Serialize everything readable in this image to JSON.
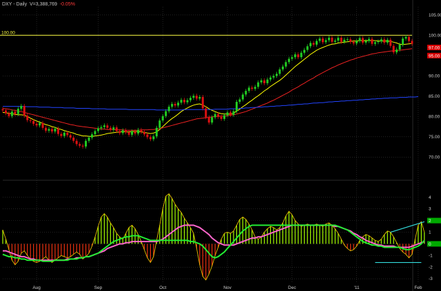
{
  "header": {
    "symbol": "DXY",
    "interval": "Daily",
    "sep": " - ",
    "volume": "V=3,388,769",
    "change": "-0.05%"
  },
  "reference_line": {
    "label": "100.00",
    "value": 100
  },
  "colors": {
    "background": "#000000",
    "grid": "#3a3a3a",
    "up_candle": "#22cc22",
    "down_candle": "#dd1111",
    "sma_short": "#ffff00",
    "sma_mid": "#ee2222",
    "sma_long": "#2244ff",
    "reference": "#ffff44",
    "hist_pos": "#a6ff00",
    "hist_neg": "#ee3311",
    "osc_line": "#ff66cc",
    "signal_line": "#22ee33",
    "divergence": "#33dddd",
    "axis_text": "#cfcfcf"
  },
  "chart_data": {
    "type": "candlestick",
    "price_axis": {
      "ticks": [
        "105.00",
        "100.00",
        "95.00",
        "90.00",
        "85.00",
        "80.00",
        "75.00",
        "70.00"
      ],
      "ylim": [
        67,
        107
      ],
      "current_labels": [
        "97.00",
        "95.00"
      ]
    },
    "osc_axis": {
      "ticks": [
        "4",
        "3",
        "2",
        "1",
        "0",
        "-1",
        "-2",
        "-3"
      ],
      "ylim": [
        -3.4,
        4.4
      ],
      "current_labels": [
        "2",
        "0"
      ]
    },
    "x_labels": [
      "Aug",
      "Sep",
      "Oct",
      "Nov",
      "Dec",
      "'11",
      "Feb"
    ],
    "x_label_index": [
      11,
      31,
      52,
      73,
      94,
      115,
      135
    ],
    "close": [
      81.5,
      80.8,
      80.1,
      81.2,
      80.6,
      81.9,
      82.6,
      80.2,
      79.1,
      78.9,
      78.2,
      77.8,
      78.4,
      77.2,
      76.5,
      76.9,
      76.3,
      77.0,
      75.7,
      75.2,
      76.0,
      75.4,
      74.8,
      74.0,
      73.2,
      72.8,
      72.6,
      74.0,
      74.8,
      75.6,
      76.4,
      77.1,
      77.4,
      77.8,
      77.2,
      76.7,
      77.3,
      76.4,
      75.9,
      76.6,
      76.1,
      75.5,
      76.3,
      75.8,
      76.7,
      76.2,
      75.6,
      74.9,
      74.4,
      75.1,
      77.2,
      79.0,
      80.1,
      81.3,
      82.4,
      83.1,
      82.7,
      83.4,
      84.1,
      83.5,
      84.0,
      84.6,
      85.1,
      84.4,
      84.8,
      82.0,
      79.8,
      78.5,
      79.8,
      80.6,
      79.9,
      79.4,
      80.3,
      81.0,
      80.4,
      81.3,
      83.6,
      84.2,
      85.4,
      86.3,
      87.1,
      86.8,
      87.3,
      88.4,
      88.9,
      88.2,
      89.1,
      89.6,
      90.0,
      90.5,
      91.6,
      92.3,
      93.4,
      94.2,
      94.6,
      95.3,
      94.6,
      95.7,
      96.4,
      97.3,
      98.1,
      97.7,
      98.6,
      99.2,
      98.3,
      98.8,
      99.4,
      98.4,
      98.7,
      99.4,
      98.4,
      98.9,
      99.0,
      98.4,
      98.0,
      98.6,
      99.3,
      98.2,
      98.6,
      99.1,
      97.9,
      98.3,
      98.5,
      99.0,
      98.2,
      98.9,
      97.4,
      95.8,
      96.5,
      97.7,
      99.2,
      99.6,
      98.6,
      97.9
    ],
    "series": [
      {
        "name": "SMA short",
        "values": [
          81.0,
          80.9,
          80.8,
          80.7,
          80.5,
          80.4,
          80.4,
          80.3,
          80.0,
          79.6,
          79.2,
          78.9,
          78.6,
          78.3,
          78.0,
          77.8,
          77.5,
          77.3,
          77.0,
          76.8,
          76.5,
          76.3,
          76.1,
          75.9,
          75.6,
          75.4,
          75.2,
          75.2,
          75.1,
          75.1,
          75.2,
          75.3,
          75.4,
          75.6,
          75.8,
          75.9,
          76.0,
          76.1,
          76.2,
          76.3,
          76.2,
          76.2,
          76.3,
          76.3,
          76.3,
          76.2,
          76.1,
          75.9,
          75.8,
          75.9,
          76.2,
          76.8,
          77.5,
          78.2,
          78.9,
          79.5,
          80.0,
          80.6,
          81.2,
          81.7,
          82.1,
          82.5,
          82.8,
          83.0,
          83.1,
          82.8,
          82.4,
          81.9,
          81.5,
          81.2,
          80.9,
          80.7,
          80.6,
          80.6,
          80.6,
          80.8,
          81.3,
          81.8,
          82.4,
          82.9,
          83.5,
          84.0,
          84.6,
          85.1,
          85.7,
          86.3,
          86.8,
          87.4,
          87.9,
          88.4,
          88.9,
          89.5,
          90.2,
          90.9,
          91.6,
          92.3,
          92.9,
          93.5,
          94.1,
          94.7,
          95.3,
          95.8,
          96.3,
          96.7,
          97.0,
          97.3,
          97.6,
          97.8,
          97.9,
          98.1,
          98.2,
          98.3,
          98.4,
          98.5,
          98.6,
          98.6,
          98.7,
          98.7,
          98.7,
          98.7,
          98.7,
          98.7,
          98.6,
          98.6,
          98.6,
          98.6,
          98.5,
          98.3,
          98.1,
          97.8,
          97.7,
          97.8,
          97.9,
          98.0
        ]
      },
      {
        "name": "SMA mid",
        "values": [
          82.0,
          81.9,
          81.8,
          81.6,
          81.5,
          81.3,
          81.2,
          81.0,
          80.8,
          80.6,
          80.4,
          80.2,
          80.0,
          79.8,
          79.6,
          79.4,
          79.2,
          79.0,
          78.8,
          78.6,
          78.4,
          78.2,
          78.0,
          77.9,
          77.7,
          77.6,
          77.5,
          77.4,
          77.3,
          77.2,
          77.1,
          77.0,
          76.9,
          76.9,
          76.8,
          76.8,
          76.8,
          76.7,
          76.7,
          76.7,
          76.6,
          76.6,
          76.6,
          76.6,
          76.6,
          76.7,
          76.7,
          76.7,
          76.8,
          76.8,
          76.9,
          77.0,
          77.2,
          77.4,
          77.6,
          77.8,
          78.0,
          78.2,
          78.4,
          78.6,
          78.8,
          79.0,
          79.2,
          79.4,
          79.5,
          79.6,
          79.7,
          79.8,
          79.9,
          80.0,
          80.0,
          80.1,
          80.1,
          80.2,
          80.3,
          80.4,
          80.6,
          80.8,
          81.0,
          81.2,
          81.5,
          81.8,
          82.1,
          82.4,
          82.7,
          83.0,
          83.3,
          83.7,
          84.0,
          84.4,
          84.8,
          85.2,
          85.6,
          86.0,
          86.5,
          86.9,
          87.3,
          87.8,
          88.2,
          88.7,
          89.1,
          89.5,
          90.0,
          90.4,
          90.8,
          91.2,
          91.6,
          92.0,
          92.3,
          92.7,
          93.0,
          93.3,
          93.6,
          93.9,
          94.1,
          94.4,
          94.6,
          94.8,
          95.0,
          95.2,
          95.4,
          95.5,
          95.7,
          95.8,
          95.9,
          96.0,
          96.1,
          96.2,
          96.3,
          96.3,
          96.4,
          96.5,
          96.6,
          96.7
        ]
      },
      {
        "name": "SMA long",
        "values": [
          82.5,
          82.5,
          82.5,
          82.5,
          82.5,
          82.5,
          82.5,
          82.5,
          82.4,
          82.4,
          82.4,
          82.4,
          82.3,
          82.3,
          82.3,
          82.3,
          82.2,
          82.2,
          82.2,
          82.2,
          82.1,
          82.1,
          82.1,
          82.1,
          82.0,
          82.0,
          82.0,
          82.0,
          82.0,
          81.9,
          81.9,
          81.9,
          81.9,
          81.9,
          81.8,
          81.8,
          81.8,
          81.8,
          81.8,
          81.8,
          81.8,
          81.7,
          81.7,
          81.7,
          81.7,
          81.7,
          81.7,
          81.7,
          81.7,
          81.7,
          81.6,
          81.6,
          81.6,
          81.6,
          81.6,
          81.6,
          81.6,
          81.6,
          81.6,
          81.7,
          81.7,
          81.7,
          81.7,
          81.7,
          81.7,
          81.7,
          81.7,
          81.7,
          81.7,
          81.8,
          81.8,
          81.8,
          81.8,
          81.8,
          81.9,
          81.9,
          81.9,
          82.0,
          82.0,
          82.1,
          82.1,
          82.2,
          82.2,
          82.3,
          82.3,
          82.4,
          82.4,
          82.5,
          82.5,
          82.6,
          82.6,
          82.7,
          82.7,
          82.8,
          82.8,
          82.9,
          83.0,
          83.0,
          83.1,
          83.1,
          83.2,
          83.3,
          83.3,
          83.4,
          83.4,
          83.5,
          83.6,
          83.6,
          83.7,
          83.7,
          83.8,
          83.8,
          83.9,
          83.9,
          84.0,
          84.0,
          84.1,
          84.1,
          84.2,
          84.2,
          84.3,
          84.3,
          84.4,
          84.4,
          84.5,
          84.5,
          84.6,
          84.6,
          84.6,
          84.7,
          84.7,
          84.7,
          84.8,
          84.8,
          84.8,
          84.9
        ]
      }
    ],
    "oscillator": {
      "histogram": [
        1.2,
        0.4,
        -0.5,
        -1.4,
        -1.8,
        -1.5,
        -0.8,
        -0.6,
        -1.0,
        -1.3,
        -1.5,
        -1.6,
        -1.5,
        -1.3,
        -1.1,
        -1.4,
        -1.6,
        -1.4,
        -1.2,
        -1.0,
        -1.1,
        -1.2,
        -1.1,
        -0.9,
        -0.7,
        -0.9,
        -1.3,
        -1.1,
        -0.8,
        -0.2,
        0.6,
        1.5,
        2.3,
        2.6,
        2.3,
        1.8,
        1.4,
        0.9,
        0.6,
        0.4,
        0.9,
        1.4,
        1.6,
        1.3,
        0.8,
        0.2,
        -0.5,
        -1.2,
        -1.6,
        -1.1,
        0.3,
        1.6,
        3.0,
        4.1,
        4.3,
        3.9,
        3.4,
        3.0,
        2.7,
        2.2,
        1.8,
        1.4,
        0.9,
        -0.4,
        -1.8,
        -2.8,
        -3.1,
        -2.6,
        -1.9,
        -1.0,
        -0.3,
        0.4,
        0.9,
        1.0,
        0.9,
        1.1,
        1.6,
        2.1,
        2.3,
        2.1,
        1.7,
        1.2,
        0.6,
        0.4,
        0.6,
        1.0,
        1.3,
        1.5,
        1.4,
        1.2,
        1.4,
        1.8,
        2.4,
        2.8,
        2.5,
        2.0,
        1.7,
        1.5,
        1.6,
        1.7,
        1.6,
        1.6,
        1.7,
        1.6,
        1.5,
        1.7,
        1.8,
        1.6,
        1.3,
        0.9,
        0.4,
        -0.1,
        -0.4,
        -0.6,
        -0.5,
        -0.2,
        0.3,
        0.6,
        0.8,
        0.7,
        0.5,
        0.3,
        0.2,
        0.4,
        0.8,
        1.1,
        1.0,
        0.6,
        0.1,
        -0.4,
        -0.7,
        -0.9,
        -1.2,
        -0.9,
        0.4,
        1.6,
        1.9,
        1.0
      ],
      "osc_line": [
        -0.6,
        -0.6,
        -0.7,
        -0.8,
        -0.9,
        -1.0,
        -1.1,
        -1.1,
        -1.2,
        -1.3,
        -1.3,
        -1.4,
        -1.4,
        -1.4,
        -1.4,
        -1.4,
        -1.4,
        -1.4,
        -1.4,
        -1.4,
        -1.4,
        -1.3,
        -1.3,
        -1.3,
        -1.2,
        -1.2,
        -1.2,
        -1.1,
        -1.1,
        -1.0,
        -0.9,
        -0.8,
        -0.7,
        -0.6,
        -0.4,
        -0.3,
        -0.2,
        -0.1,
        0.0,
        0.0,
        0.1,
        0.1,
        0.2,
        0.2,
        0.2,
        0.2,
        0.2,
        0.2,
        0.2,
        0.2,
        0.2,
        0.3,
        0.4,
        0.6,
        0.8,
        1.0,
        1.2,
        1.4,
        1.5,
        1.6,
        1.6,
        1.6,
        1.6,
        1.5,
        1.4,
        1.2,
        1.0,
        0.8,
        0.5,
        0.3,
        0.1,
        0.0,
        -0.1,
        -0.1,
        -0.1,
        -0.1,
        0.0,
        0.1,
        0.2,
        0.3,
        0.4,
        0.5,
        0.5,
        0.6,
        0.6,
        0.7,
        0.8,
        0.9,
        1.0,
        1.1,
        1.2,
        1.3,
        1.4,
        1.5,
        1.6,
        1.6,
        1.6,
        1.6,
        1.6,
        1.6,
        1.6,
        1.6,
        1.6,
        1.6,
        1.6,
        1.6,
        1.6,
        1.6,
        1.5,
        1.5,
        1.4,
        1.3,
        1.2,
        1.1,
        0.9,
        0.8,
        0.6,
        0.5,
        0.3,
        0.2,
        0.1,
        0.0,
        -0.1,
        -0.1,
        -0.2,
        -0.2,
        -0.2,
        -0.2,
        -0.3,
        -0.3,
        -0.3,
        -0.3,
        -0.3,
        -0.2,
        -0.1,
        0.0,
        0.1,
        0.2
      ],
      "signal_line": [
        -0.9,
        -1.0,
        -1.1,
        -1.1,
        -1.2,
        -1.2,
        -1.3,
        -1.3,
        -1.4,
        -1.4,
        -1.4,
        -1.4,
        -1.4,
        -1.5,
        -1.5,
        -1.5,
        -1.5,
        -1.4,
        -1.4,
        -1.4,
        -1.4,
        -1.4,
        -1.3,
        -1.3,
        -1.3,
        -1.2,
        -1.2,
        -1.1,
        -1.1,
        -1.0,
        -0.9,
        -0.8,
        -0.6,
        -0.4,
        -0.2,
        0.0,
        0.2,
        0.3,
        0.4,
        0.5,
        0.6,
        0.6,
        0.7,
        0.7,
        0.7,
        0.6,
        0.5,
        0.4,
        0.3,
        0.3,
        0.3,
        0.3,
        0.3,
        0.3,
        0.3,
        0.3,
        0.3,
        0.3,
        0.3,
        0.3,
        0.3,
        0.2,
        0.2,
        0.1,
        0.0,
        -0.2,
        -0.5,
        -0.8,
        -1.1,
        -1.2,
        -1.1,
        -0.9,
        -0.7,
        -0.4,
        -0.1,
        0.2,
        0.5,
        0.8,
        1.1,
        1.3,
        1.5,
        1.6,
        1.6,
        1.6,
        1.6,
        1.6,
        1.6,
        1.6,
        1.6,
        1.6,
        1.6,
        1.6,
        1.6,
        1.6,
        1.6,
        1.6,
        1.6,
        1.6,
        1.6,
        1.6,
        1.6,
        1.6,
        1.6,
        1.6,
        1.6,
        1.6,
        1.6,
        1.6,
        1.6,
        1.5,
        1.4,
        1.3,
        1.2,
        1.0,
        0.8,
        0.6,
        0.4,
        0.2,
        0.1,
        0.0,
        -0.1,
        -0.1,
        -0.2,
        -0.2,
        -0.3,
        -0.3,
        -0.3,
        -0.3,
        -0.3,
        -0.3,
        -0.4,
        -0.5,
        -0.5,
        -0.4,
        -0.3,
        -0.2,
        0.0,
        0.3
      ]
    },
    "divergence_lines": [
      {
        "from_index": 126,
        "from_value": 1.0,
        "to_index": 137,
        "to_value": 1.9
      },
      {
        "from_index": 121,
        "from_value": -1.6,
        "to_index": 136,
        "to_value": -1.6
      }
    ]
  }
}
